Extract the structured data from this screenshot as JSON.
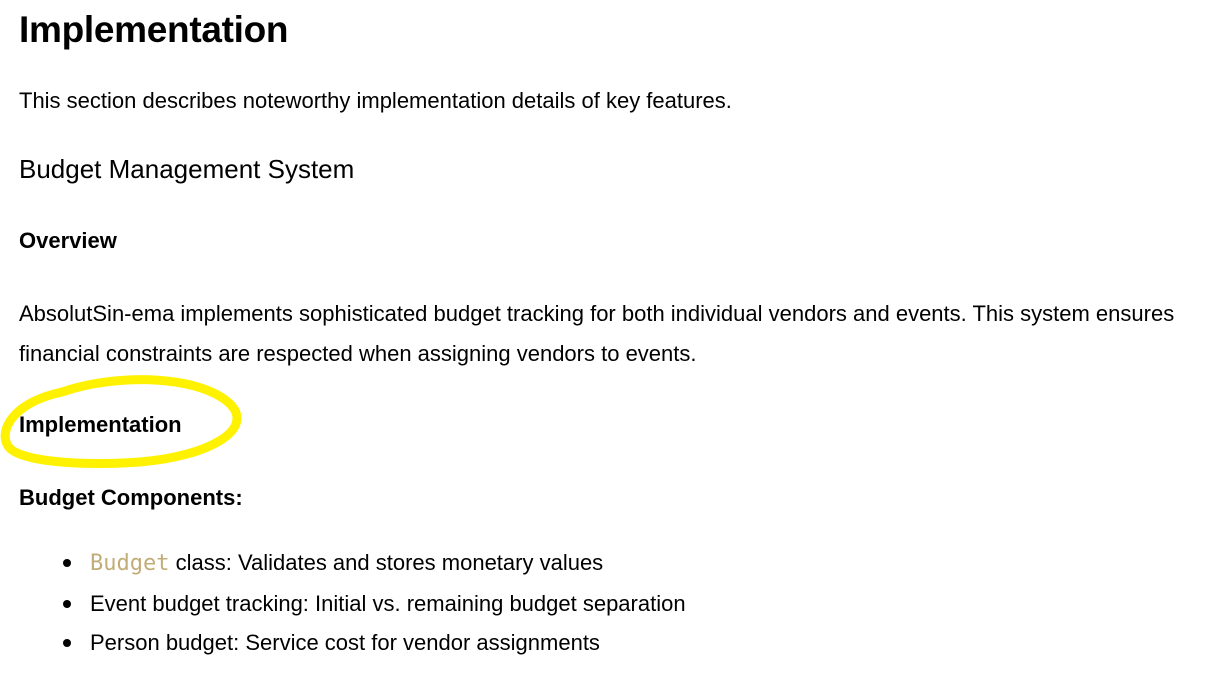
{
  "document": {
    "title": "Implementation",
    "intro": "This section describes noteworthy implementation details of key features.",
    "section_title": "Budget Management System",
    "overview_heading": "Overview",
    "overview_paragraph": "AbsolutSin-ema implements sophisticated budget tracking for both individual vendors and events. This system ensures financial constraints are respected when assigning vendors to events.",
    "implementation_heading": "Implementation",
    "components_heading": "Budget Components:",
    "components": [
      {
        "code": "Budget",
        "text": " class: Validates and stores monetary values"
      },
      {
        "text": "Event budget tracking: Initial vs. remaining budget separation"
      },
      {
        "text": "Person budget: Service cost for vendor assignments"
      }
    ]
  },
  "annotation": {
    "type": "hand-drawn ellipse",
    "color": "#fff200",
    "target": "implementation_heading"
  },
  "colors": {
    "text": "#000000",
    "code": "#c2ad78",
    "background": "#ffffff"
  }
}
